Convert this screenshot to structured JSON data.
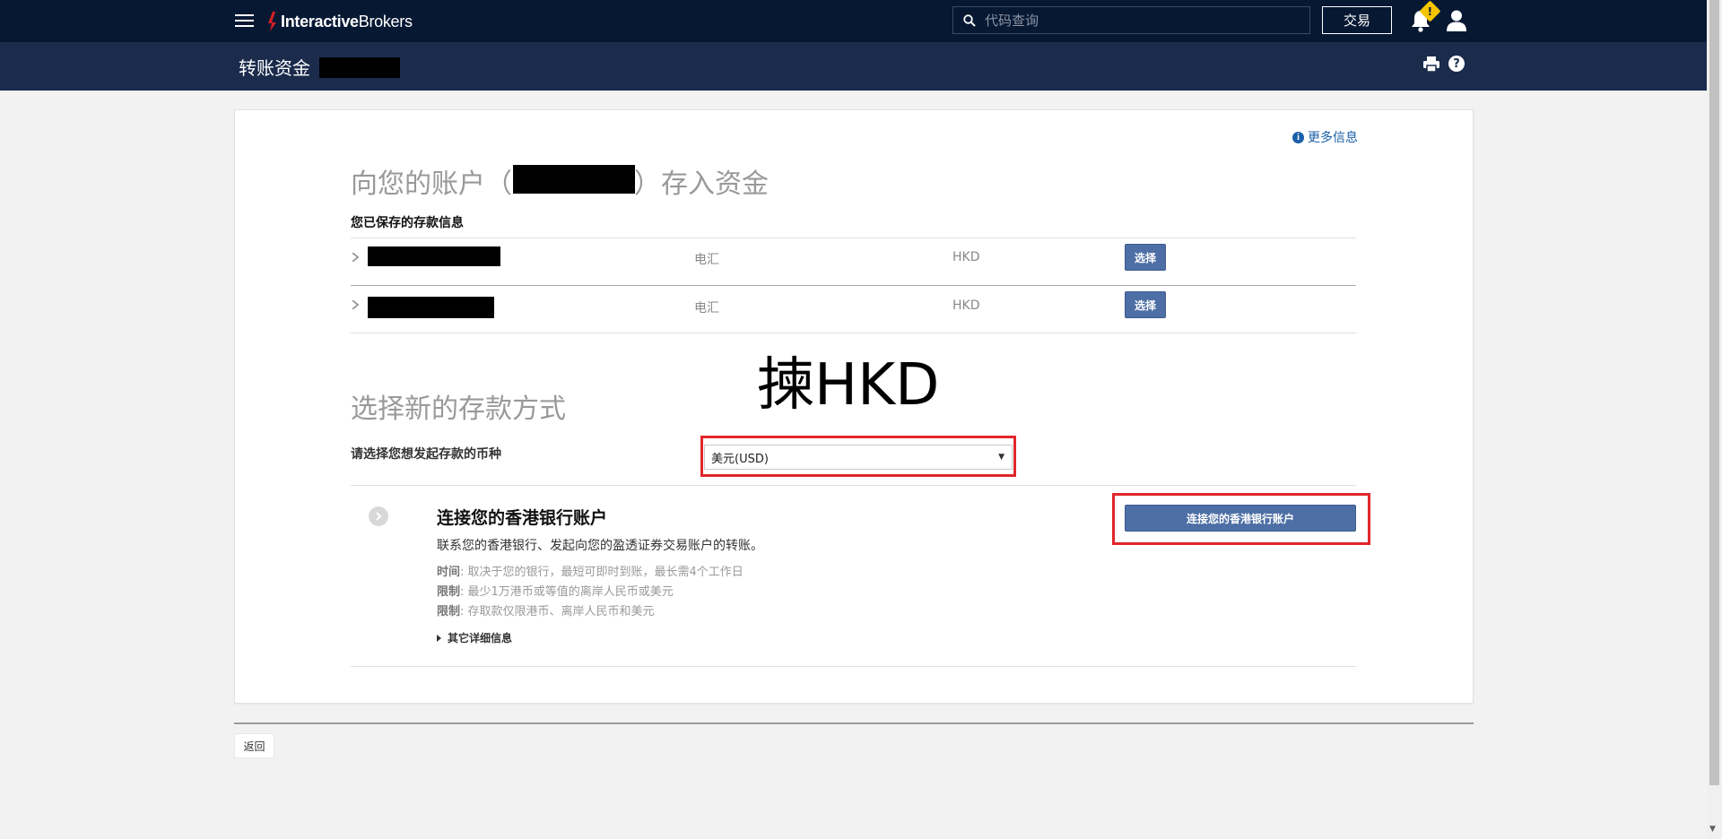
{
  "header": {
    "brand_bold": "Interactive",
    "brand_light": "Brokers",
    "search_placeholder": "代码查询",
    "trade_label": "交易",
    "notification_badge": "!"
  },
  "subheader": {
    "title": "转账资金"
  },
  "info": {
    "more_info": "更多信息"
  },
  "deposit": {
    "heading_prefix": "向您的账户（",
    "heading_suffix": "）存入资金",
    "saved_label": "您已保存的存款信息",
    "saved_rows": [
      {
        "method": "电汇",
        "currency": "HKD",
        "action": "选择"
      },
      {
        "method": "电汇",
        "currency": "HKD",
        "action": "选择"
      }
    ]
  },
  "overlay": {
    "text": "揀HKD"
  },
  "new_method": {
    "heading": "选择新的存款方式",
    "currency_label": "请选择您想发起存款的币种",
    "currency_selected": "美元(USD)",
    "method_title": "连接您的香港银行账户",
    "method_desc": "联系您的香港银行、发起向您的盈透证券交易账户的转账。",
    "details": [
      {
        "key": "时间",
        "value": ": 取决于您的银行，最短可即时到账，最长需4个工作日"
      },
      {
        "key": "限制",
        "value": ": 最少1万港币或等值的离岸人民币或美元"
      },
      {
        "key": "限制",
        "value": ": 存取款仅限港币、离岸人民币和美元"
      }
    ],
    "other_details": "其它详细信息",
    "connect_button": "连接您的香港银行账户"
  },
  "footer": {
    "back_label": "返回"
  },
  "colors": {
    "nav_bg": "#071833",
    "subnav_bg": "#1a2b4c",
    "button_blue": "#4e6fa5",
    "highlight_red": "#e0262b",
    "badge_yellow": "#f5c400"
  }
}
